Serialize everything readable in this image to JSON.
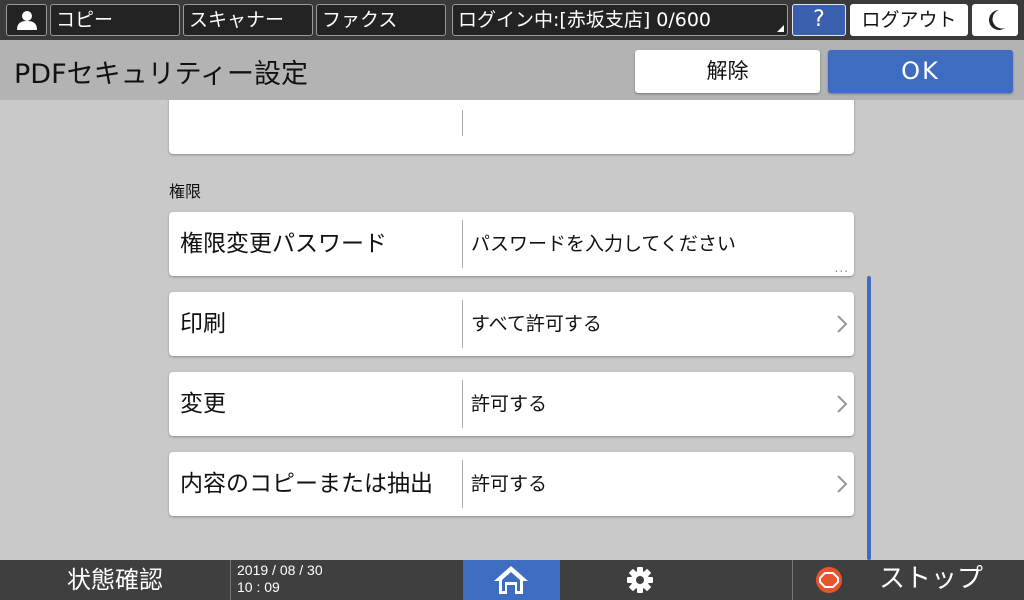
{
  "topbar": {
    "user_icon": "user-icon",
    "copy": "コピー",
    "scanner": "スキャナー",
    "fax": "ファクス",
    "login_status": "ログイン中:[赤坂支店] 0/600",
    "help": "?",
    "logout": "ログアウト",
    "sleep_icon": "moon-icon"
  },
  "header": {
    "title": "PDFセキュリティー設定",
    "release_button": "解除",
    "ok_button": "OK"
  },
  "section": {
    "label": "権限"
  },
  "rows": [
    {
      "label": "権限変更パスワード",
      "value": "パスワードを入力してください",
      "more": "..."
    },
    {
      "label": "印刷",
      "value": "すべて許可する"
    },
    {
      "label": "変更",
      "value": "許可する"
    },
    {
      "label": "内容のコピーまたは抽出",
      "value": "許可する"
    }
  ],
  "bottombar": {
    "status_check": "状態確認",
    "date": "2019 / 08 / 30",
    "time": "10 : 09",
    "stop": "ストップ"
  },
  "colors": {
    "accent": "#3d6cc0",
    "bar_dark": "#3a3a3a",
    "title_bar": "#b3b3b3",
    "content_bg": "#c9c9c9",
    "stop_icon": "#e8552d"
  }
}
